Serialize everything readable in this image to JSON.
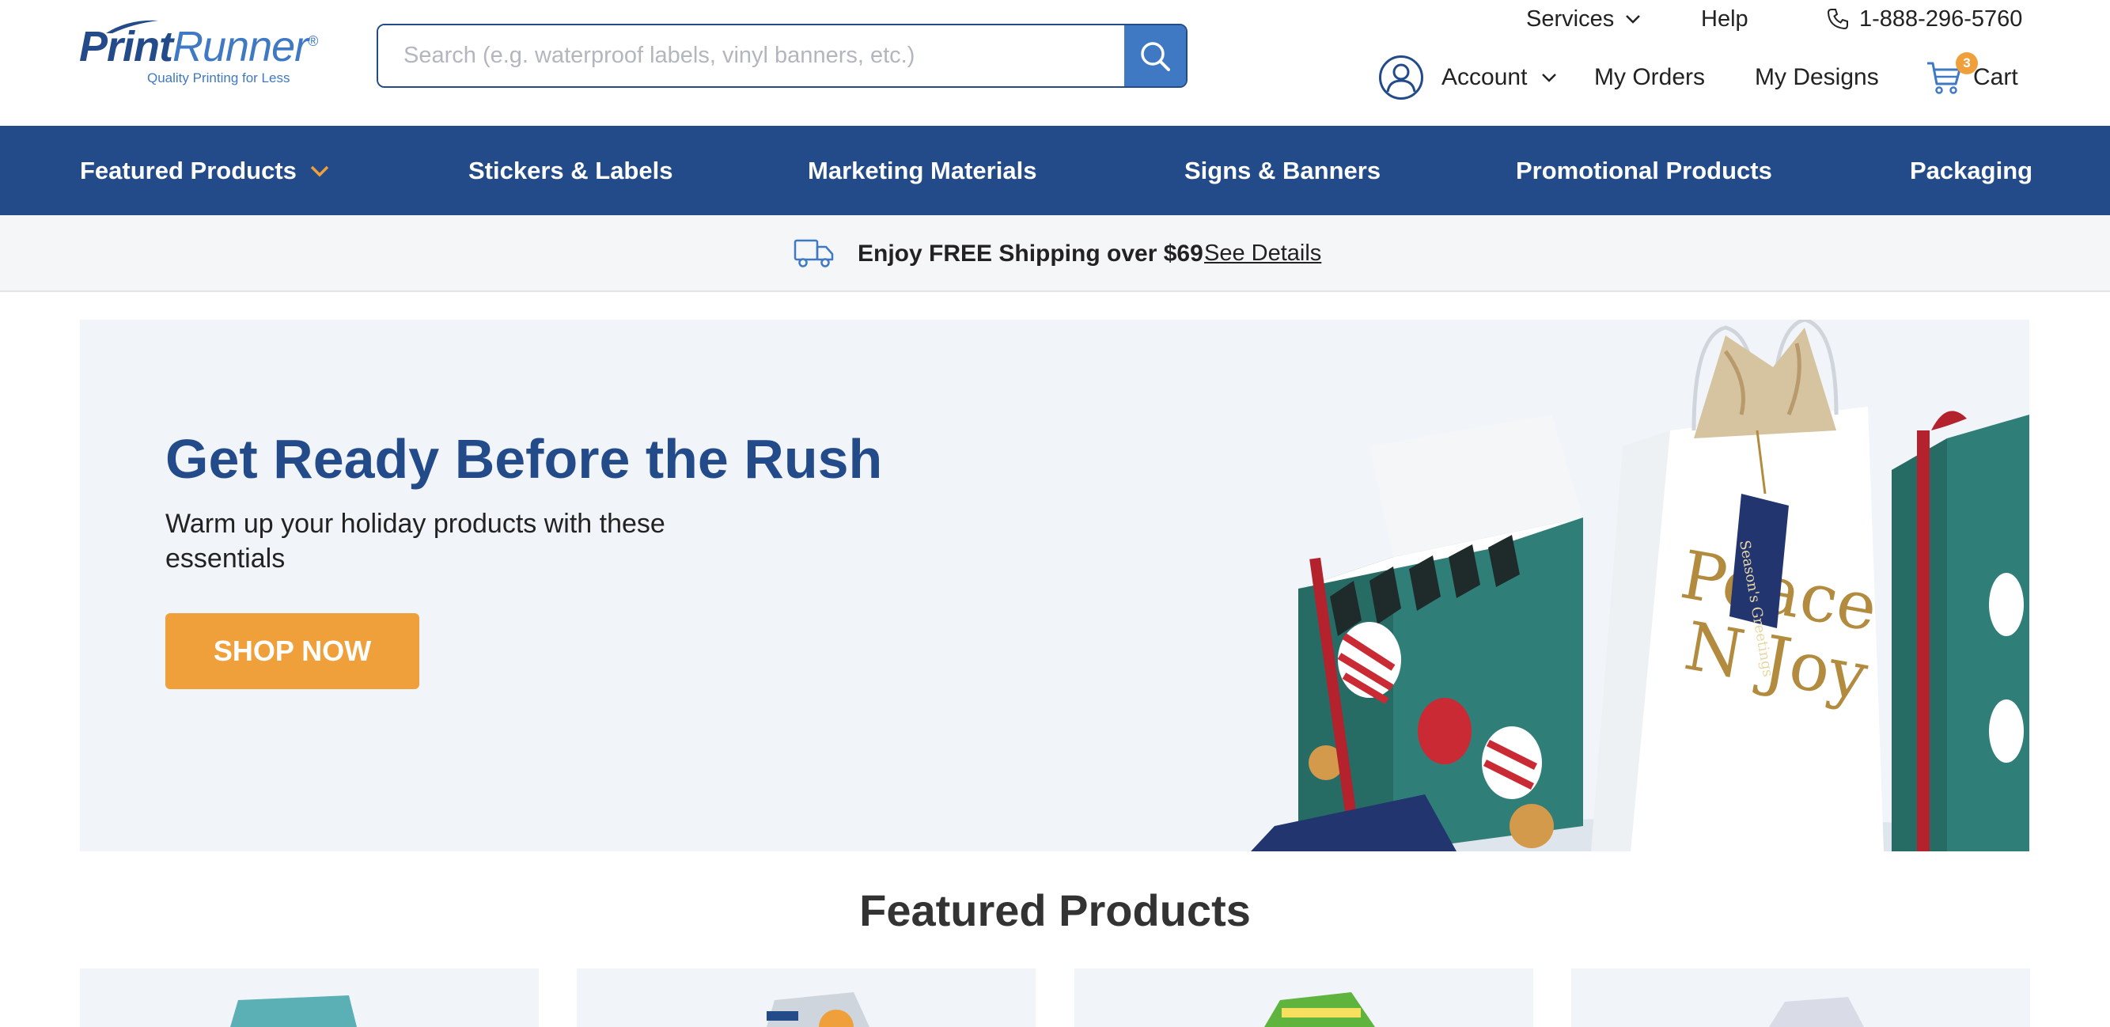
{
  "brand": {
    "logo_bold": "Print",
    "logo_light": "Runner",
    "logo_mark": "®",
    "tagline": "Quality Printing for Less"
  },
  "search": {
    "placeholder": "Search (e.g. waterproof labels, vinyl banners, etc.)",
    "value": "",
    "button_icon": "search-icon"
  },
  "utility_nav": {
    "services": "Services",
    "help": "Help",
    "phone": "1-888-296-5760"
  },
  "account_nav": {
    "account": "Account",
    "orders": "My Orders",
    "designs": "My Designs",
    "cart": "Cart",
    "cart_count": "3"
  },
  "categories": [
    "Featured Products",
    "Stickers & Labels",
    "Marketing Materials",
    "Signs & Banners",
    "Promotional Products",
    "Packaging"
  ],
  "shipping": {
    "message": "Enjoy FREE Shipping over $69",
    "link": "See Details"
  },
  "hero": {
    "title": "Get Ready Before the Rush",
    "subtitle": "Warm up your holiday products with these essentials",
    "button": "SHOP NOW",
    "bag_text_1": "Peace",
    "bag_text_2": "N Joy",
    "tag_text": "Season's Greetings"
  },
  "featured": {
    "title": "Featured Products"
  },
  "colors": {
    "brand_blue": "#234b8a",
    "accent_blue": "#3f78c3",
    "accent_orange": "#f0a03a",
    "teal_box": "#2f7f78",
    "hero_bg": "#f1f5f9"
  }
}
